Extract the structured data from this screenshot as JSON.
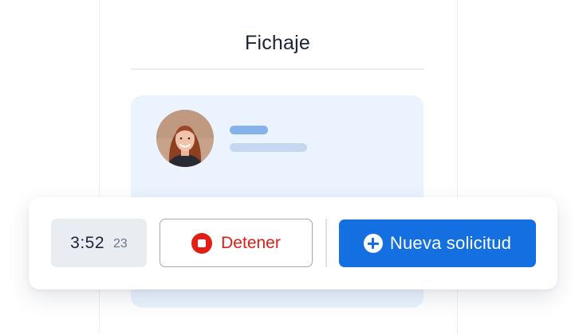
{
  "header": {
    "title": "Fichaje"
  },
  "profile": {
    "avatar_icon": "person-photo",
    "name_placeholder_color": "#86b2ea",
    "detail_placeholder_color": "#c5d8ef"
  },
  "toolbar": {
    "timer": {
      "main": "3:52",
      "seconds": "23"
    },
    "stop_button": {
      "label": "Detener",
      "icon": "stop-circle-icon",
      "color": "#e21d16"
    },
    "new_request_button": {
      "label": "Nueva solicitud",
      "icon": "plus-circle-icon",
      "color": "#1470e0"
    }
  }
}
